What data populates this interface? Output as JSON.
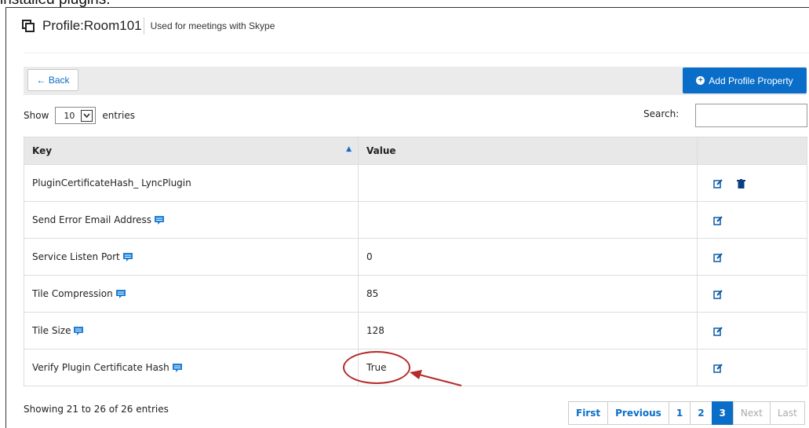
{
  "top_caption": "installed plugins.",
  "profile": {
    "title": "Profile:Room101",
    "description": "Used for meetings with Skype"
  },
  "toolbar": {
    "back_label": "← Back",
    "add_label": "Add Profile Property"
  },
  "length": {
    "show_label": "Show",
    "value": "10",
    "entries_label": "entries"
  },
  "search": {
    "label": "Search:",
    "value": ""
  },
  "table": {
    "headers": [
      "Key",
      "Value",
      ""
    ],
    "rows": [
      {
        "key": "PluginCertificateHash_ LyncPlugin",
        "value": ""
      },
      {
        "key": "Send Error Email Address",
        "value": ""
      },
      {
        "key": "Service Listen Port",
        "value": "0"
      },
      {
        "key": "Tile Compression",
        "value": "85"
      },
      {
        "key": "Tile Size",
        "value": "128"
      },
      {
        "key": "Verify Plugin Certificate Hash",
        "value": "True"
      }
    ]
  },
  "info_text": "Showing 21 to 26 of 26 entries",
  "pagination": [
    "First",
    "Previous",
    "1",
    "2",
    "3",
    "Next",
    "Last"
  ],
  "colors": {
    "accent": "#0a6ec9",
    "annotation": "#b52b2b"
  }
}
